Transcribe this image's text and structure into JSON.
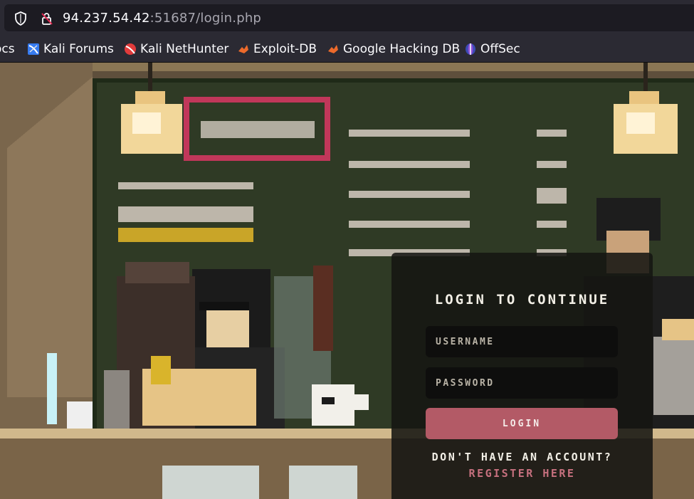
{
  "browser": {
    "url_host": "94.237.54.42",
    "url_rest": ":51687/login.php"
  },
  "bookmarks": [
    {
      "label": "ocs",
      "icon": "kali-docs-icon"
    },
    {
      "label": "Kali Forums",
      "icon": "kali-forums-icon"
    },
    {
      "label": "Kali NetHunter",
      "icon": "kali-nethunter-icon"
    },
    {
      "label": "Exploit-DB",
      "icon": "exploit-db-icon"
    },
    {
      "label": "Google Hacking DB",
      "icon": "ghdb-icon"
    },
    {
      "label": "OffSec",
      "icon": "offsec-icon"
    }
  ],
  "login": {
    "title": "LOGIN TO CONTINUE",
    "username_placeholder": "USERNAME",
    "password_placeholder": "PASSWORD",
    "button_label": "LOGIN",
    "no_account_text": "DON'T HAVE AN ACCOUNT?",
    "register_label": "REGISTER HERE"
  },
  "colors": {
    "accent": "#b35a66",
    "register_link": "#c6707e",
    "chalkboard": "#2f3a25"
  }
}
